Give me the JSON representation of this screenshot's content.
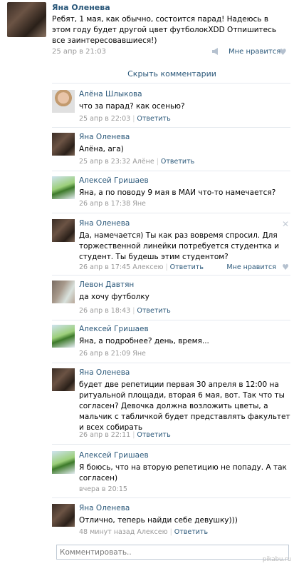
{
  "post": {
    "author": "Яна Оленева",
    "text": "Ребят, 1 мая, как обычно, состоится парад! Надеюсь в этом году будет другой цвет футболокXDD Отпишитесь все заинтересовавшиеся!)",
    "time": "25 апр в 21:03",
    "like_label": "Мне нравится"
  },
  "hide_comments": "Скрыть комментарии",
  "comments": [
    {
      "author": "Алёна Шлыкова",
      "text": "что за парад? как осенью?",
      "time": "25 апр в 22:03",
      "reply": "Ответить",
      "reply_to": ""
    },
    {
      "author": "Яна Оленева",
      "text": "Алёна, ага)",
      "time": "25 апр в 23:32",
      "reply_to": "Алёне",
      "reply": "Ответить"
    },
    {
      "author": "Алексей Гришаев",
      "text": "Яна, а по поводу 9 мая в МАИ что-то намечается?",
      "time": "26 апр в 17:38",
      "reply_to": "Яне",
      "reply": ""
    },
    {
      "author": "Яна Оленева",
      "text": "Да, намечается) Ты как раз вовремя спросил. Для торжественной линейки потребуется студентка и студент. Ты будешь этим студентом?",
      "time": "26 апр в 17:45",
      "reply_to": "Алексею",
      "reply": "Ответить",
      "like_label": "Мне нравится"
    },
    {
      "author": "Левон Давтян",
      "text": "да хочу футболку",
      "time": "26 апр в 18:43",
      "reply_to": "",
      "reply": "Ответить"
    },
    {
      "author": "Алексей Гришаев",
      "text": "Яна, а подробнее? день, время...",
      "time": "26 апр в 21:09",
      "reply_to": "Яне",
      "reply": ""
    },
    {
      "author": "Яна Оленева",
      "text": "будет две репетиции первая 30 апреля в 12:00 на ритуальной площади, вторая 6 мая, вот. Так что ты согласен? Девочка должна возложить цветы, а мальчик с табличкой будет представлять факультет и всех собирать",
      "time": "26 апр в 22:11",
      "reply_to": "",
      "reply": "Ответить"
    },
    {
      "author": "Алексей Гришаев",
      "text": "Я боюсь, что на вторую репетицию не попаду. А так согласен)",
      "time": "вчера в 20:15",
      "reply_to": "",
      "reply": ""
    },
    {
      "author": "Яна Оленева",
      "text": "Отлично, теперь найди себе девушку)))",
      "time": "48 минут назад",
      "reply_to": "Алексею",
      "reply": "Ответить"
    }
  ],
  "comment_input": {
    "placeholder": "Комментировать.."
  },
  "watermark": "pikabu.ru",
  "colors": {
    "link": "#2b587a",
    "meta": "#999999",
    "separator": "#e6eaef"
  }
}
